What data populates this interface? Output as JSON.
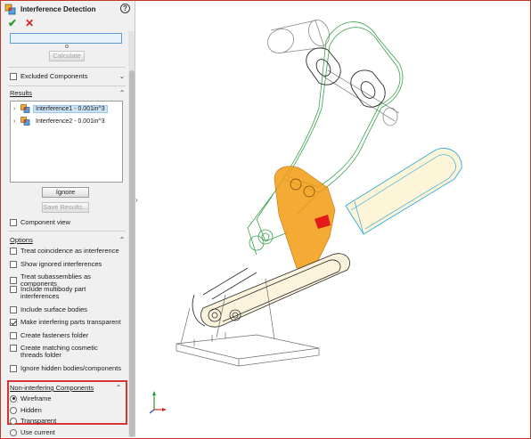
{
  "panel": {
    "title": "Interference Detection",
    "help": "?",
    "ok": "✔",
    "cancel": "✕",
    "calculate_label": "Calculate",
    "excluded_components_label": "Excluded Components",
    "results_label": "Results",
    "results": [
      {
        "label": "Interference1 - 0.001in^3",
        "selected": true
      },
      {
        "label": "Interference2 - 0.001in^3",
        "selected": false
      }
    ],
    "ignore_label": "Ignore",
    "save_results_label": "Save Results...",
    "component_view_label": "Component view",
    "options_label": "Options",
    "options": [
      {
        "label": "Treat coincidence as interference",
        "checked": false
      },
      {
        "label": "Show ignored interferences",
        "checked": false
      },
      {
        "label": "Treat subassemblies as components",
        "checked": false
      },
      {
        "label": "Include multibody part interferences",
        "checked": false
      },
      {
        "label": "Include surface bodies",
        "checked": false
      },
      {
        "label": "Make interfering parts transparent",
        "checked": true
      },
      {
        "label": "Create fasteners folder",
        "checked": false
      },
      {
        "label": "Create matching cosmetic threads folder",
        "checked": false
      },
      {
        "label": "Ignore hidden bodies/components",
        "checked": false
      }
    ],
    "non_interfering_label": "Non-interfering Components",
    "non_interfering_options": [
      {
        "label": "Wireframe",
        "selected": true
      },
      {
        "label": "Hidden",
        "selected": false
      },
      {
        "label": "Transparent",
        "selected": false
      },
      {
        "label": "Use current",
        "selected": false
      }
    ]
  },
  "triad": {
    "y": "Y",
    "x": "X",
    "z": "Z"
  },
  "colors": {
    "accent_red": "#d33434",
    "selection_blue": "#5c9ad6",
    "interfering_part": "#f39c12",
    "wire_green": "#3aa14a",
    "wire_cyan": "#33aadd"
  }
}
